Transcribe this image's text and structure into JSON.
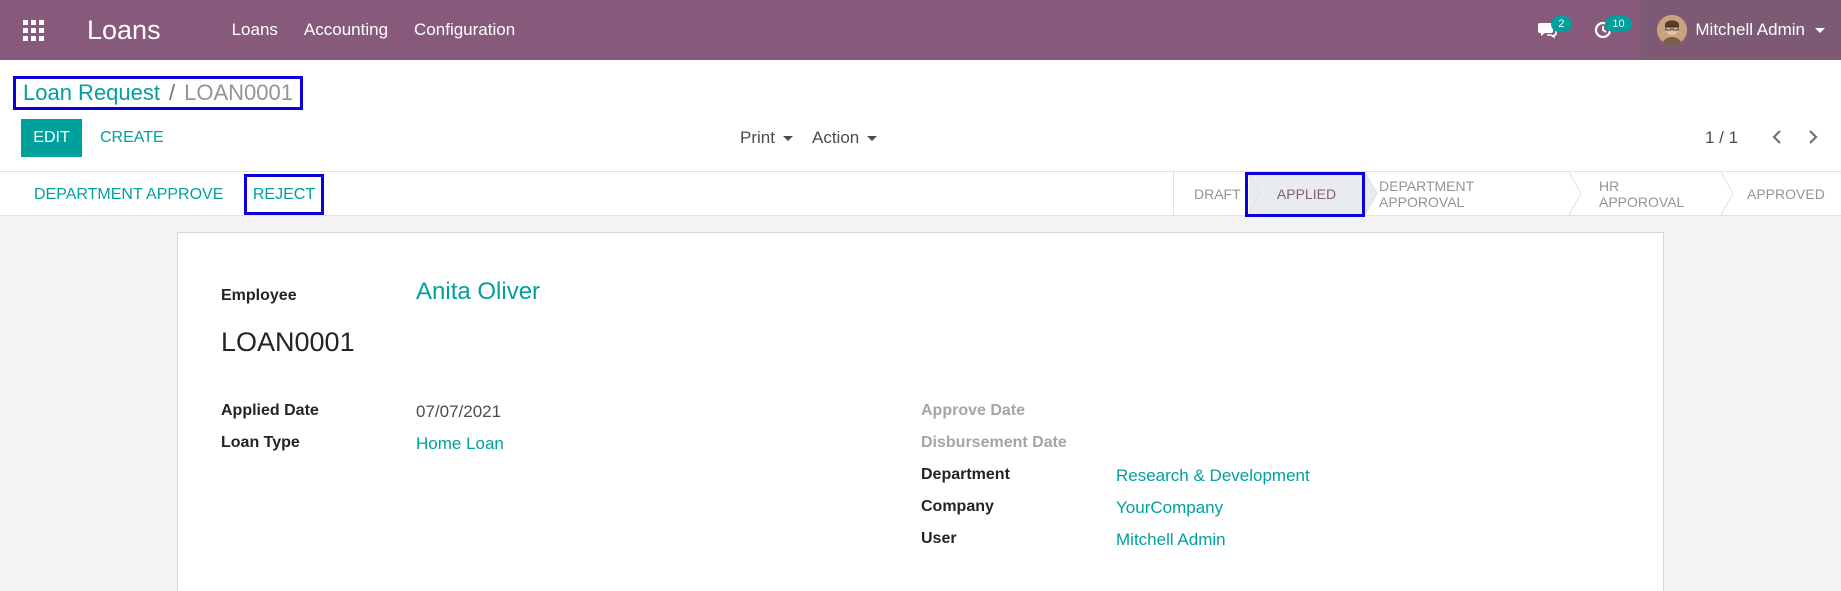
{
  "navbar": {
    "app_name": "Loans",
    "menu": [
      "Loans",
      "Accounting",
      "Configuration"
    ],
    "messages_count": "2",
    "activities_count": "10",
    "user_name": "Mitchell Admin",
    "icons": [
      "apps-grid-icon",
      "chat-icon",
      "clock-icon"
    ]
  },
  "breadcrumb": {
    "parent": "Loan Request",
    "separator": "/",
    "current": "LOAN0001"
  },
  "buttons": {
    "edit": "EDIT",
    "create": "CREATE",
    "print": "Print",
    "action": "Action"
  },
  "pager": {
    "value": "1 / 1"
  },
  "status_buttons": {
    "department_approve": "DEPARTMENT APPROVE",
    "reject": "REJECT"
  },
  "stages": [
    "DRAFT",
    "APPLIED",
    "DEPARTMENT APPOROVAL",
    "HR APPOROVAL",
    "APPROVED"
  ],
  "active_stage": "APPLIED",
  "form": {
    "employee_label": "Employee",
    "employee_value": "Anita Oliver",
    "reference": "LOAN0001",
    "applied_date_label": "Applied Date",
    "applied_date_value": "07/07/2021",
    "loan_type_label": "Loan Type",
    "loan_type_value": "Home Loan",
    "approve_date_label": "Approve Date",
    "disbursement_date_label": "Disbursement Date",
    "department_label": "Department",
    "department_value": "Research & Development",
    "company_label": "Company",
    "company_value": "YourCompany",
    "user_label": "User",
    "user_value": "Mitchell Admin"
  },
  "colors": {
    "navbar": "#875a7b",
    "accent": "#00a09d",
    "highlight_box": "#0c00d8"
  }
}
